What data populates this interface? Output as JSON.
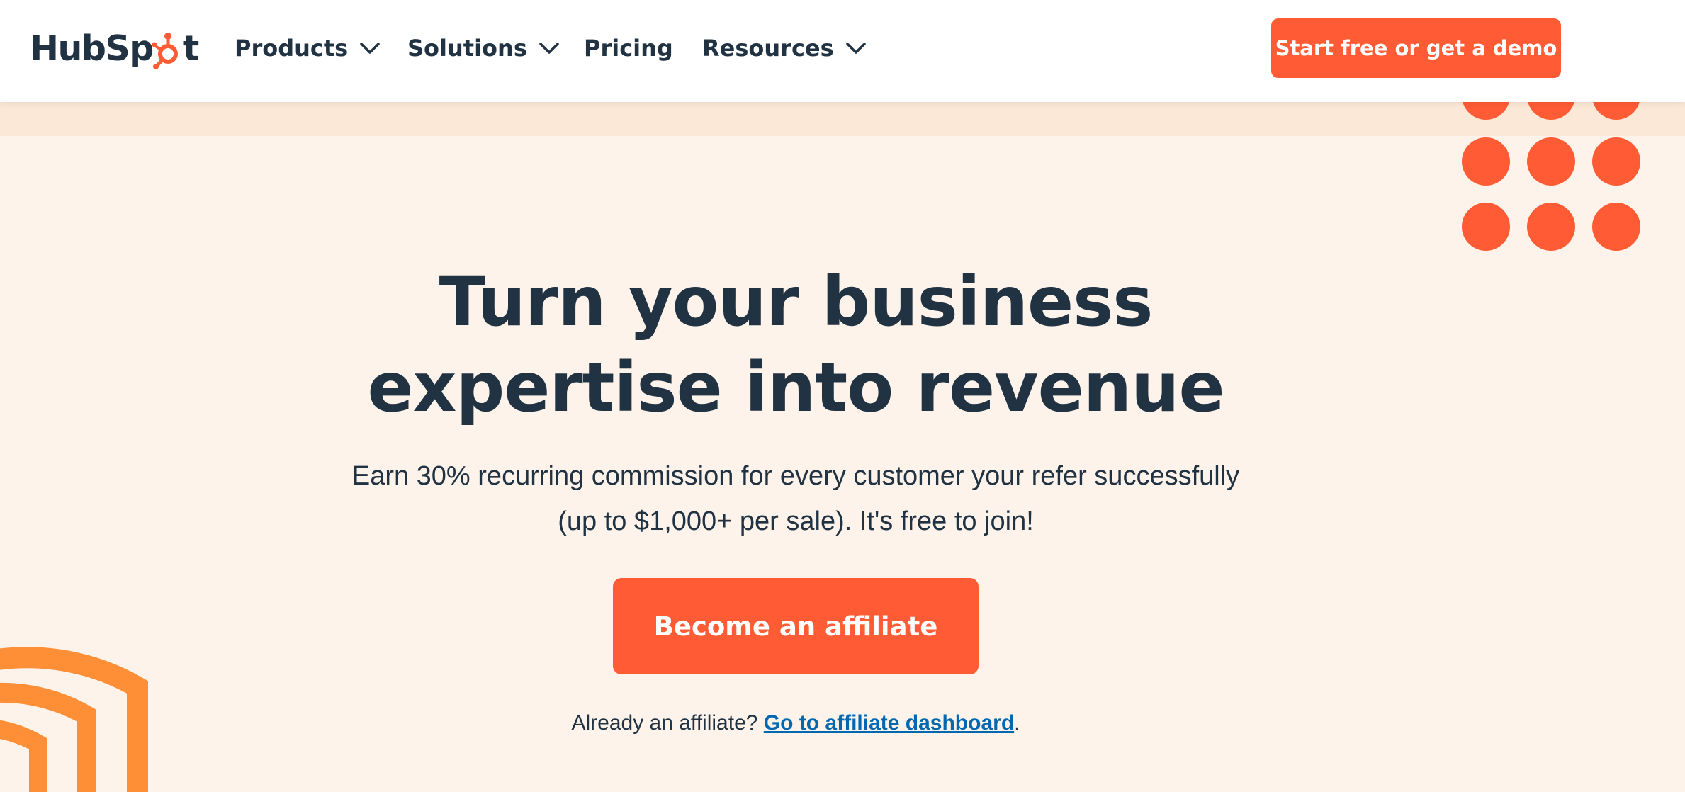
{
  "brand": {
    "logo_text_a": "HubSp",
    "logo_text_b": "t",
    "accent_color": "#ff5c35",
    "arch_color": "#ff8f36",
    "text_color": "#213343",
    "link_color": "#0068b1"
  },
  "nav": {
    "items": [
      {
        "label": "Products",
        "has_dropdown": true,
        "icon": "chevron-down-icon"
      },
      {
        "label": "Solutions",
        "has_dropdown": true,
        "icon": "chevron-down-icon"
      },
      {
        "label": "Pricing",
        "has_dropdown": false
      },
      {
        "label": "Resources",
        "has_dropdown": true,
        "icon": "chevron-down-icon"
      }
    ],
    "cta_label": "Start free or get a demo"
  },
  "hero": {
    "title_line1": "Turn your business",
    "title_line2": "expertise into revenue",
    "subtitle_line1": "Earn 30% recurring commission for every customer your refer successfully",
    "subtitle_line2": "(up to $1,000+ per sale). It's free to join!",
    "cta_label": "Become an affiliate",
    "existing_prefix": "Already an affiliate? ",
    "existing_link": "Go to affiliate dashboard",
    "existing_suffix": "."
  }
}
